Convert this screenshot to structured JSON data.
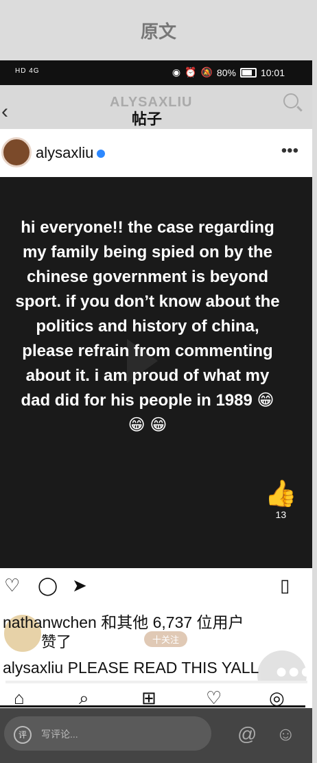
{
  "label": {
    "title": "原文"
  },
  "status": {
    "left": "HD 4G",
    "battery": "80%",
    "time": "10:01"
  },
  "header": {
    "app_title": "ALYSAXLIU",
    "page_title": "帖子"
  },
  "profile": {
    "username": "alysaxliu"
  },
  "post": {
    "text": "hi everyone!! the case regarding my family being spied on by the chinese government is beyond sport. if you don’t know about the politics and history of china, please refrain from commenting about it. i am proud of what my dad did for his people in 1989 😁 😁 😁",
    "like_count": "13"
  },
  "likes": {
    "line1": "nathanwchen 和其他 6,737 位用户",
    "line2": "赞了",
    "follow": "十关注"
  },
  "caption": {
    "user": "alysaxliu",
    "text": "PLEASE READ THIS YALL"
  },
  "commentbar": {
    "placeholder": "写评论..."
  }
}
